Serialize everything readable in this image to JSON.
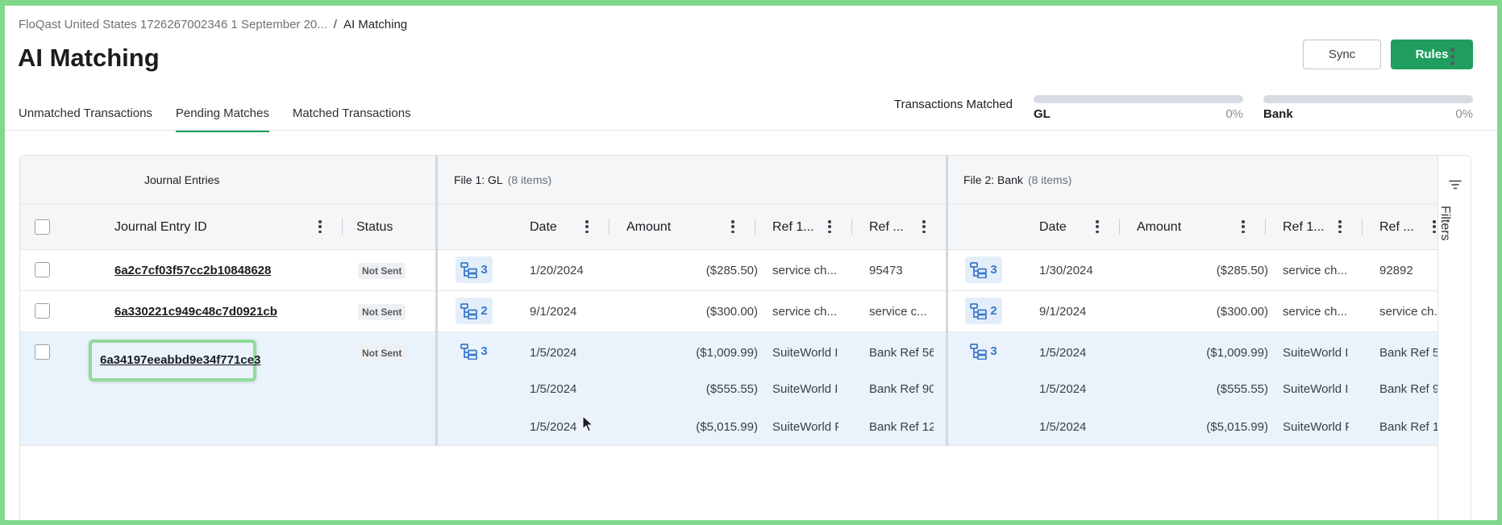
{
  "breadcrumb": {
    "parent": "FloQast United States 1726267002346 1 September 20...",
    "separator": "/",
    "current": "AI Matching"
  },
  "page_title": "AI Matching",
  "header_actions": {
    "sync": "Sync",
    "rules": "Rules"
  },
  "tabs": [
    {
      "label": "Unmatched Transactions",
      "active": false
    },
    {
      "label": "Pending Matches",
      "active": true
    },
    {
      "label": "Matched Transactions",
      "active": false
    }
  ],
  "progress": {
    "label": "Transactions Matched",
    "gl": {
      "name": "GL",
      "pct_text": "0%",
      "value": 0
    },
    "bank": {
      "name": "Bank",
      "pct_text": "0%",
      "value": 0
    }
  },
  "table": {
    "groups": {
      "journal": "Journal Entries",
      "file1": {
        "title": "File 1: GL",
        "count": "(8 items)"
      },
      "file2": {
        "title": "File 2: Bank",
        "count": "(8 items)"
      }
    },
    "headers": {
      "je_id": "Journal Entry ID",
      "status": "Status",
      "gl_date": "Date",
      "gl_amount": "Amount",
      "gl_ref1": "Ref 1...",
      "gl_ref2": "Ref ...",
      "bank_date": "Date",
      "bank_amount": "Amount",
      "bank_ref1": "Ref 1...",
      "bank_ref2": "Ref ..."
    },
    "rows": [
      {
        "je_id": "6a2c7cf03f57cc2b10848628",
        "status": "Not Sent",
        "gl_count": "3",
        "bank_count": "3",
        "gl": [
          {
            "date": "1/20/2024",
            "amount": "($285.50)",
            "ref1": "service ch...",
            "ref2": "95473"
          }
        ],
        "bank": [
          {
            "date": "1/30/2024",
            "amount": "($285.50)",
            "ref1": "service ch...",
            "ref2": "92892"
          }
        ]
      },
      {
        "je_id": "6a330221c949c48c7d0921cb",
        "status": "Not Sent",
        "gl_count": "2",
        "bank_count": "2",
        "gl": [
          {
            "date": "9/1/2024",
            "amount": "($300.00)",
            "ref1": "service ch...",
            "ref2": "service c..."
          }
        ],
        "bank": [
          {
            "date": "9/1/2024",
            "amount": "($300.00)",
            "ref1": "service ch...",
            "ref2": "service ch..."
          }
        ]
      },
      {
        "je_id": "6a34197eeabbd9e34f771ce3",
        "status": "Not Sent",
        "gl_count": "3",
        "bank_count": "3",
        "gl": [
          {
            "date": "1/5/2024",
            "amount": "($1,009.99)",
            "ref1": "SuiteWorld I",
            "ref2": "Bank Ref 56"
          },
          {
            "date": "1/5/2024",
            "amount": "($555.55)",
            "ref1": "SuiteWorld I",
            "ref2": "Bank Ref 90"
          },
          {
            "date": "1/5/2024",
            "amount": "($5,015.99)",
            "ref1": "SuiteWorld F",
            "ref2": "Bank Ref 12"
          }
        ],
        "bank": [
          {
            "date": "1/5/2024",
            "amount": "($1,009.99)",
            "ref1": "SuiteWorld I",
            "ref2": "Bank Ref 5"
          },
          {
            "date": "1/5/2024",
            "amount": "($555.55)",
            "ref1": "SuiteWorld I",
            "ref2": "Bank Ref 9"
          },
          {
            "date": "1/5/2024",
            "amount": "($5,015.99)",
            "ref1": "SuiteWorld F",
            "ref2": "Bank Ref 1"
          }
        ]
      }
    ]
  },
  "filters_label": "Filters",
  "colors": {
    "accent": "#1f9e5f",
    "link_blue": "#3a78c9",
    "highlight": "#8fdc99",
    "selected_row": "#eaf2fb"
  }
}
